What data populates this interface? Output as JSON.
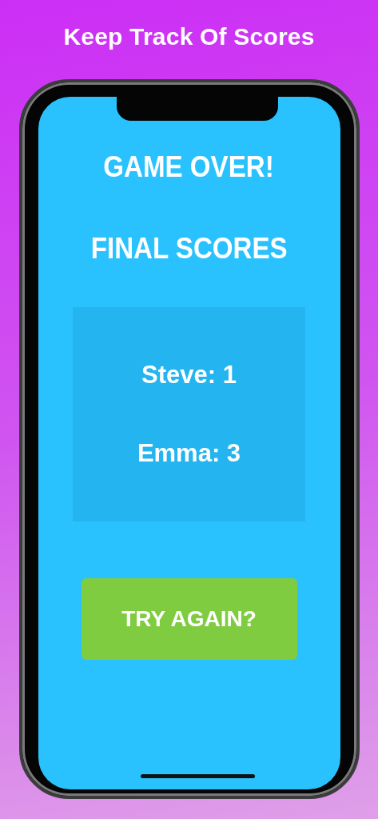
{
  "headline": "Keep Track Of Scores",
  "screen": {
    "title": "GAME OVER!",
    "subtitle": "FINAL SCORES",
    "scores": [
      {
        "text": "Steve: 1"
      },
      {
        "text": "Emma: 3"
      }
    ],
    "button": "TRY AGAIN?"
  }
}
